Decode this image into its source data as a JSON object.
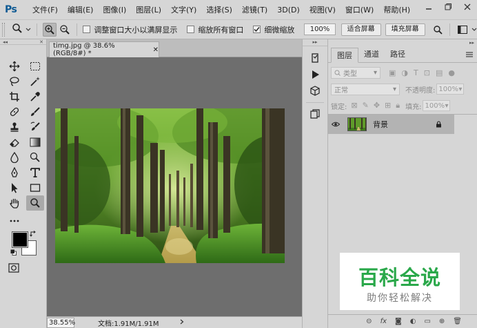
{
  "app": {
    "logo": "Ps",
    "menu": [
      "文件(F)",
      "编辑(E)",
      "图像(I)",
      "图层(L)",
      "文字(Y)",
      "选择(S)",
      "滤镜(T)",
      "3D(D)",
      "视图(V)",
      "窗口(W)",
      "帮助(H)"
    ]
  },
  "options": {
    "checkbox_resize": "调整窗口大小以满屏显示",
    "checkbox_zoom_all": "缩放所有窗口",
    "checkbox_scrubby": "细微缩放",
    "scrubby_checked": true,
    "zoom_value": "100%",
    "fit_screen": "适合屏幕",
    "fill_screen": "填充屏幕"
  },
  "document": {
    "tab_title": "timg.jpg @ 38.6%(RGB/8#) *",
    "zoom_status": "38.55%",
    "doc_info": "文档:1.91M/1.91M"
  },
  "layers_panel": {
    "tabs": [
      "图层",
      "通道",
      "路径"
    ],
    "kind_filter": "类型",
    "blend_mode": "正常",
    "opacity_label": "不透明度:",
    "opacity_value": "100%",
    "lock_label": "锁定:",
    "fill_label": "填充:",
    "fill_value": "100%",
    "layers": [
      {
        "name": "背景",
        "locked": true,
        "visible": true
      }
    ]
  },
  "watermark": {
    "title": "百科全说",
    "subtitle": "助你轻松解决"
  },
  "colors": {
    "foreground": "#000000",
    "background": "#ffffff",
    "canvas_bg": "#6e6e6e",
    "watermark_green": "#2aa84a"
  }
}
